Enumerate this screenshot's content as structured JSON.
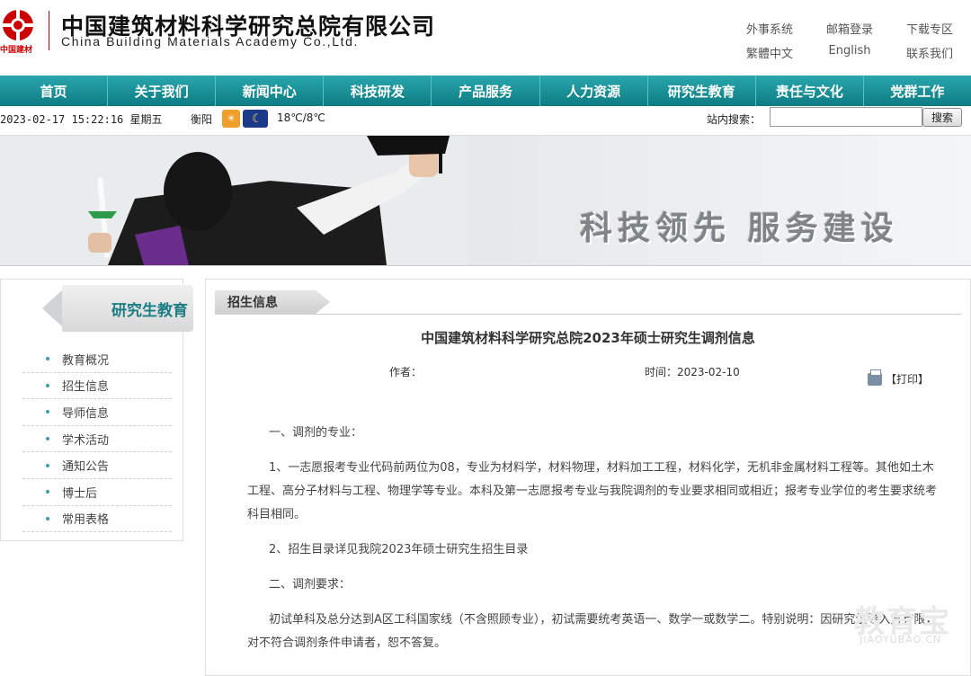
{
  "header": {
    "name_cn": "中国建筑材料科学研究总院有限公司",
    "name_en": "China Building Materials Academy Co.,Ltd.",
    "logo_text": "中国建材",
    "links_row1": [
      "外事系统",
      "邮箱登录",
      "下载专区"
    ],
    "links_row2": [
      "繁體中文",
      "English",
      "联系我们"
    ]
  },
  "nav": [
    "首页",
    "关于我们",
    "新闻中心",
    "科技研发",
    "产品服务",
    "人力资源",
    "研究生教育",
    "责任与文化",
    "党群工作"
  ],
  "infobar": {
    "datetime": "2023-02-17 15:22:16 星期五",
    "city": "衡阳",
    "temperature": "18℃/8℃",
    "search_label": "站内搜索：",
    "search_value": "",
    "search_button": "搜索"
  },
  "banner": {
    "slogan": "科技领先  服务建设"
  },
  "sidebar": {
    "title": "研究生教育",
    "items": [
      "教育概况",
      "招生信息",
      "导师信息",
      "学术活动",
      "通知公告",
      "博士后",
      "常用表格"
    ]
  },
  "main": {
    "tab": "招生信息",
    "title": "中国建筑材料科学研究总院2023年硕士研究生调剂信息",
    "author_label": "作者：",
    "time_label": "时间：2023-02-10",
    "print_label": "【打印】",
    "paragraphs": [
      "一、调剂的专业：",
      "1、一志愿报考专业代码前两位为08，专业为材料学，材料物理，材料加工工程，材料化学，无机非金属材料工程等。其他如土木工程、高分子材料与工程、物理学等专业。本科及第一志愿报考专业与我院调剂的专业要求相同或相近；报考专业学位的考生要求统考科目相同。",
      "2、招生目录详见我院2023年硕士研究生招生目录",
      "二、调剂要求：",
      "初试单科及总分达到A区工科国家线（不含照顾专业），初试需要统考英语一、数学一或数学二。特别说明：因研究生导入方有限，对不符合调剂条件申请者，恕不答复。"
    ]
  },
  "watermark": {
    "main": "教育宝",
    "sub": "JIAOYUBAO.CN"
  },
  "colors": {
    "nav": "#1a9098",
    "accent": "#1e7d84",
    "logo_red": "#cc0000"
  }
}
